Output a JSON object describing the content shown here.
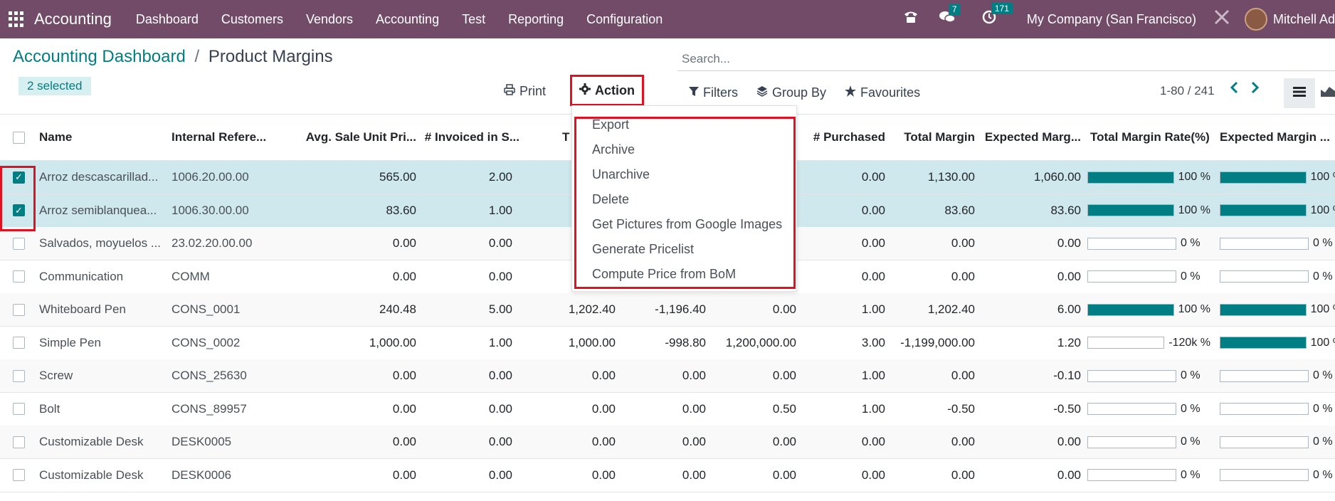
{
  "navbar": {
    "app_name": "Accounting",
    "menu": [
      "Dashboard",
      "Customers",
      "Vendors",
      "Accounting",
      "Test",
      "Reporting",
      "Configuration"
    ],
    "messages_count": "7",
    "activities_count": "171",
    "company": "My Company (San Francisco)",
    "user": "Mitchell Ad"
  },
  "breadcrumb": {
    "parent": "Accounting Dashboard",
    "separator": "/",
    "current": "Product Margins"
  },
  "selected_label": "2 selected",
  "search": {
    "placeholder": "Search..."
  },
  "toolbar": {
    "print": "Print",
    "action": "Action",
    "filters": "Filters",
    "group_by": "Group By",
    "favourites": "Favourites"
  },
  "pager": {
    "range": "1-80 / 241"
  },
  "table": {
    "columns": [
      "Name",
      "Internal Refere...",
      "Avg. Sale Unit Pri...",
      "# Invoiced in S...",
      "T",
      "# Purchased",
      "Total Margin",
      "Expected Marg...",
      "Total Margin Rate(%)",
      "Expected Margin ..."
    ],
    "rows": [
      {
        "checked": true,
        "name": "Arroz descascarillad...",
        "ref": "1006.20.00.00",
        "avg": "565.00",
        "inv": "2.00",
        "c5": "",
        "c6": "",
        "c7": "",
        "purchased": "0.00",
        "margin": "1,130.00",
        "expected": "1,060.00",
        "rate": "100 %",
        "rate_fill": 100,
        "exp_rate": "100 %",
        "exp_fill": 100
      },
      {
        "checked": true,
        "name": "Arroz semiblanquea...",
        "ref": "1006.30.00.00",
        "avg": "83.60",
        "inv": "1.00",
        "c5": "",
        "c6": "",
        "c7": "",
        "purchased": "0.00",
        "margin": "83.60",
        "expected": "83.60",
        "rate": "100 %",
        "rate_fill": 100,
        "exp_rate": "100 %",
        "exp_fill": 100
      },
      {
        "checked": false,
        "name": "Salvados, moyuelos ...",
        "ref": "23.02.20.00.00",
        "avg": "0.00",
        "inv": "0.00",
        "c5": "",
        "c6": "",
        "c7": "",
        "purchased": "0.00",
        "margin": "0.00",
        "expected": "0.00",
        "rate": "0 %",
        "rate_fill": 0,
        "exp_rate": "0 %",
        "exp_fill": 0
      },
      {
        "checked": false,
        "name": "Communication",
        "ref": "COMM",
        "avg": "0.00",
        "inv": "0.00",
        "c5": "",
        "c6": "",
        "c7": "",
        "purchased": "0.00",
        "margin": "0.00",
        "expected": "0.00",
        "rate": "0 %",
        "rate_fill": 0,
        "exp_rate": "0 %",
        "exp_fill": 0
      },
      {
        "checked": false,
        "name": "Whiteboard Pen",
        "ref": "CONS_0001",
        "avg": "240.48",
        "inv": "5.00",
        "c5": "1,202.40",
        "c6": "-1,196.40",
        "c7": "0.00",
        "purchased": "1.00",
        "margin": "1,202.40",
        "expected": "6.00",
        "rate": "100 %",
        "rate_fill": 100,
        "exp_rate": "100 %",
        "exp_fill": 100
      },
      {
        "checked": false,
        "name": "Simple Pen",
        "ref": "CONS_0002",
        "avg": "1,000.00",
        "inv": "1.00",
        "c5": "1,000.00",
        "c6": "-998.80",
        "c7": "1,200,000.00",
        "purchased": "3.00",
        "margin": "-1,199,000.00",
        "expected": "1.20",
        "rate": "-120k %",
        "rate_fill": 0,
        "exp_rate": "100 %",
        "exp_fill": 100
      },
      {
        "checked": false,
        "name": "Screw",
        "ref": "CONS_25630",
        "avg": "0.00",
        "inv": "0.00",
        "c5": "0.00",
        "c6": "0.00",
        "c7": "0.00",
        "purchased": "1.00",
        "margin": "0.00",
        "expected": "-0.10",
        "rate": "0 %",
        "rate_fill": 0,
        "exp_rate": "0 %",
        "exp_fill": 0
      },
      {
        "checked": false,
        "name": "Bolt",
        "ref": "CONS_89957",
        "avg": "0.00",
        "inv": "0.00",
        "c5": "0.00",
        "c6": "0.00",
        "c7": "0.50",
        "purchased": "1.00",
        "margin": "-0.50",
        "expected": "-0.50",
        "rate": "0 %",
        "rate_fill": 0,
        "exp_rate": "0 %",
        "exp_fill": 0
      },
      {
        "checked": false,
        "name": "Customizable Desk",
        "ref": "DESK0005",
        "avg": "0.00",
        "inv": "0.00",
        "c5": "0.00",
        "c6": "0.00",
        "c7": "0.00",
        "purchased": "0.00",
        "margin": "0.00",
        "expected": "0.00",
        "rate": "0 %",
        "rate_fill": 0,
        "exp_rate": "0 %",
        "exp_fill": 0
      },
      {
        "checked": false,
        "name": "Customizable Desk",
        "ref": "DESK0006",
        "avg": "0.00",
        "inv": "0.00",
        "c5": "0.00",
        "c6": "0.00",
        "c7": "0.00",
        "purchased": "0.00",
        "margin": "0.00",
        "expected": "0.00",
        "rate": "0 %",
        "rate_fill": 0,
        "exp_rate": "0 %",
        "exp_fill": 0
      }
    ]
  },
  "action_menu": [
    "Export",
    "Archive",
    "Unarchive",
    "Delete",
    "Get Pictures from Google Images",
    "Generate Pricelist",
    "Compute Price from BoM"
  ],
  "colors": {
    "navbar": "#714B67",
    "accent": "#017e84",
    "highlight": "#e3101f",
    "selected_row": "#cfe8ed"
  }
}
